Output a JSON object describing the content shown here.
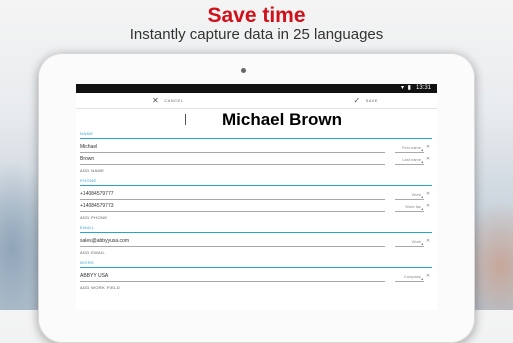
{
  "promo": {
    "headline": "Save time",
    "subline": "Instantly capture data in 25 languages"
  },
  "statusbar": {
    "signal_icons": "▾ ▮",
    "time": "13:31"
  },
  "actionbar": {
    "cancel_label": "CANCEL",
    "save_label": "SAVE"
  },
  "contact": {
    "display_name": "Michael Brown"
  },
  "form": {
    "name_section": "NAME",
    "first_name": {
      "value": "Michael",
      "type": "First name"
    },
    "last_name": {
      "value": "Brown",
      "type": "Last name"
    },
    "add_name": "ADD NAME",
    "phone_section": "PHONE",
    "phones": [
      {
        "value": "+14084579777",
        "type": "Work"
      },
      {
        "value": "+14084579773",
        "type": "Work fax"
      }
    ],
    "add_phone": "ADD PHONE",
    "email_section": "EMAIL",
    "emails": [
      {
        "value": "sales@abbyyusa.com",
        "type": "Work"
      }
    ],
    "add_email": "ADD EMAIL",
    "work_section": "WORK",
    "company": {
      "value": "ABBYY USA",
      "type": "Company"
    },
    "add_work_field": "ADD WORK FIELD"
  },
  "colors": {
    "headline": "#d0101a",
    "accent": "#29a3d6"
  }
}
